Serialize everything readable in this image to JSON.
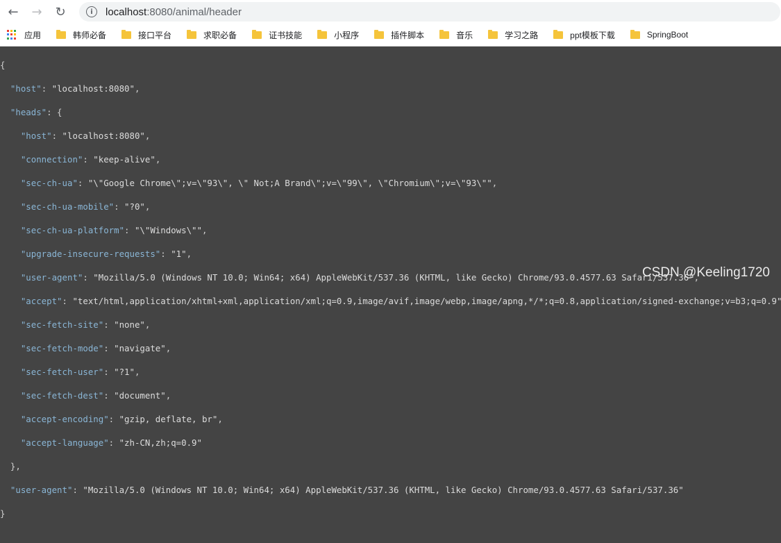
{
  "browser": {
    "url_host": "localhost",
    "url_path": ":8080/animal/header",
    "bookmarks": [
      {
        "label": "应用",
        "icon": "apps-grid-icon"
      },
      {
        "label": "韩师必备",
        "icon": "folder-icon"
      },
      {
        "label": "接口平台",
        "icon": "folder-icon"
      },
      {
        "label": "求职必备",
        "icon": "folder-icon"
      },
      {
        "label": "证书技能",
        "icon": "folder-icon"
      },
      {
        "label": "小程序",
        "icon": "folder-icon"
      },
      {
        "label": "插件脚本",
        "icon": "folder-icon"
      },
      {
        "label": "音乐",
        "icon": "folder-icon"
      },
      {
        "label": "学习之路",
        "icon": "folder-icon"
      },
      {
        "label": "ppt模板下载",
        "icon": "folder-icon"
      },
      {
        "label": "SpringBoot",
        "icon": "folder-icon"
      }
    ]
  },
  "json_view": {
    "open": "{",
    "host_key": "\"host\"",
    "host_val": "\"localhost:8080\"",
    "heads_key": "\"heads\"",
    "heads": [
      {
        "k": "\"host\"",
        "v": "\"localhost:8080\""
      },
      {
        "k": "\"connection\"",
        "v": "\"keep-alive\""
      },
      {
        "k": "\"sec-ch-ua\"",
        "v": "\"\\\"Google Chrome\\\";v=\\\"93\\\", \\\" Not;A Brand\\\";v=\\\"99\\\", \\\"Chromium\\\";v=\\\"93\\\"\""
      },
      {
        "k": "\"sec-ch-ua-mobile\"",
        "v": "\"?0\""
      },
      {
        "k": "\"sec-ch-ua-platform\"",
        "v": "\"\\\"Windows\\\"\""
      },
      {
        "k": "\"upgrade-insecure-requests\"",
        "v": "\"1\""
      },
      {
        "k": "\"user-agent\"",
        "v": "\"Mozilla/5.0 (Windows NT 10.0; Win64; x64) AppleWebKit/537.36 (KHTML, like Gecko) Chrome/93.0.4577.63 Safari/537.36\""
      },
      {
        "k": "\"accept\"",
        "v": "\"text/html,application/xhtml+xml,application/xml;q=0.9,image/avif,image/webp,image/apng,*/*;q=0.8,application/signed-exchange;v=b3;q=0.9\""
      },
      {
        "k": "\"sec-fetch-site\"",
        "v": "\"none\""
      },
      {
        "k": "\"sec-fetch-mode\"",
        "v": "\"navigate\""
      },
      {
        "k": "\"sec-fetch-user\"",
        "v": "\"?1\""
      },
      {
        "k": "\"sec-fetch-dest\"",
        "v": "\"document\""
      },
      {
        "k": "\"accept-encoding\"",
        "v": "\"gzip, deflate, br\""
      },
      {
        "k": "\"accept-language\"",
        "v": "\"zh-CN,zh;q=0.9\""
      }
    ],
    "heads_close": "},",
    "ua_key": "\"user-agent\"",
    "ua_val": "\"Mozilla/5.0 (Windows NT 10.0; Win64; x64) AppleWebKit/537.36 (KHTML, like Gecko) Chrome/93.0.4577.63 Safari/537.36\"",
    "close": "}"
  },
  "watermark": "CSDN @Keeling1720",
  "colors": {
    "background": "#444444",
    "key": "#8ab6d6",
    "folder": "#f5c43b"
  }
}
